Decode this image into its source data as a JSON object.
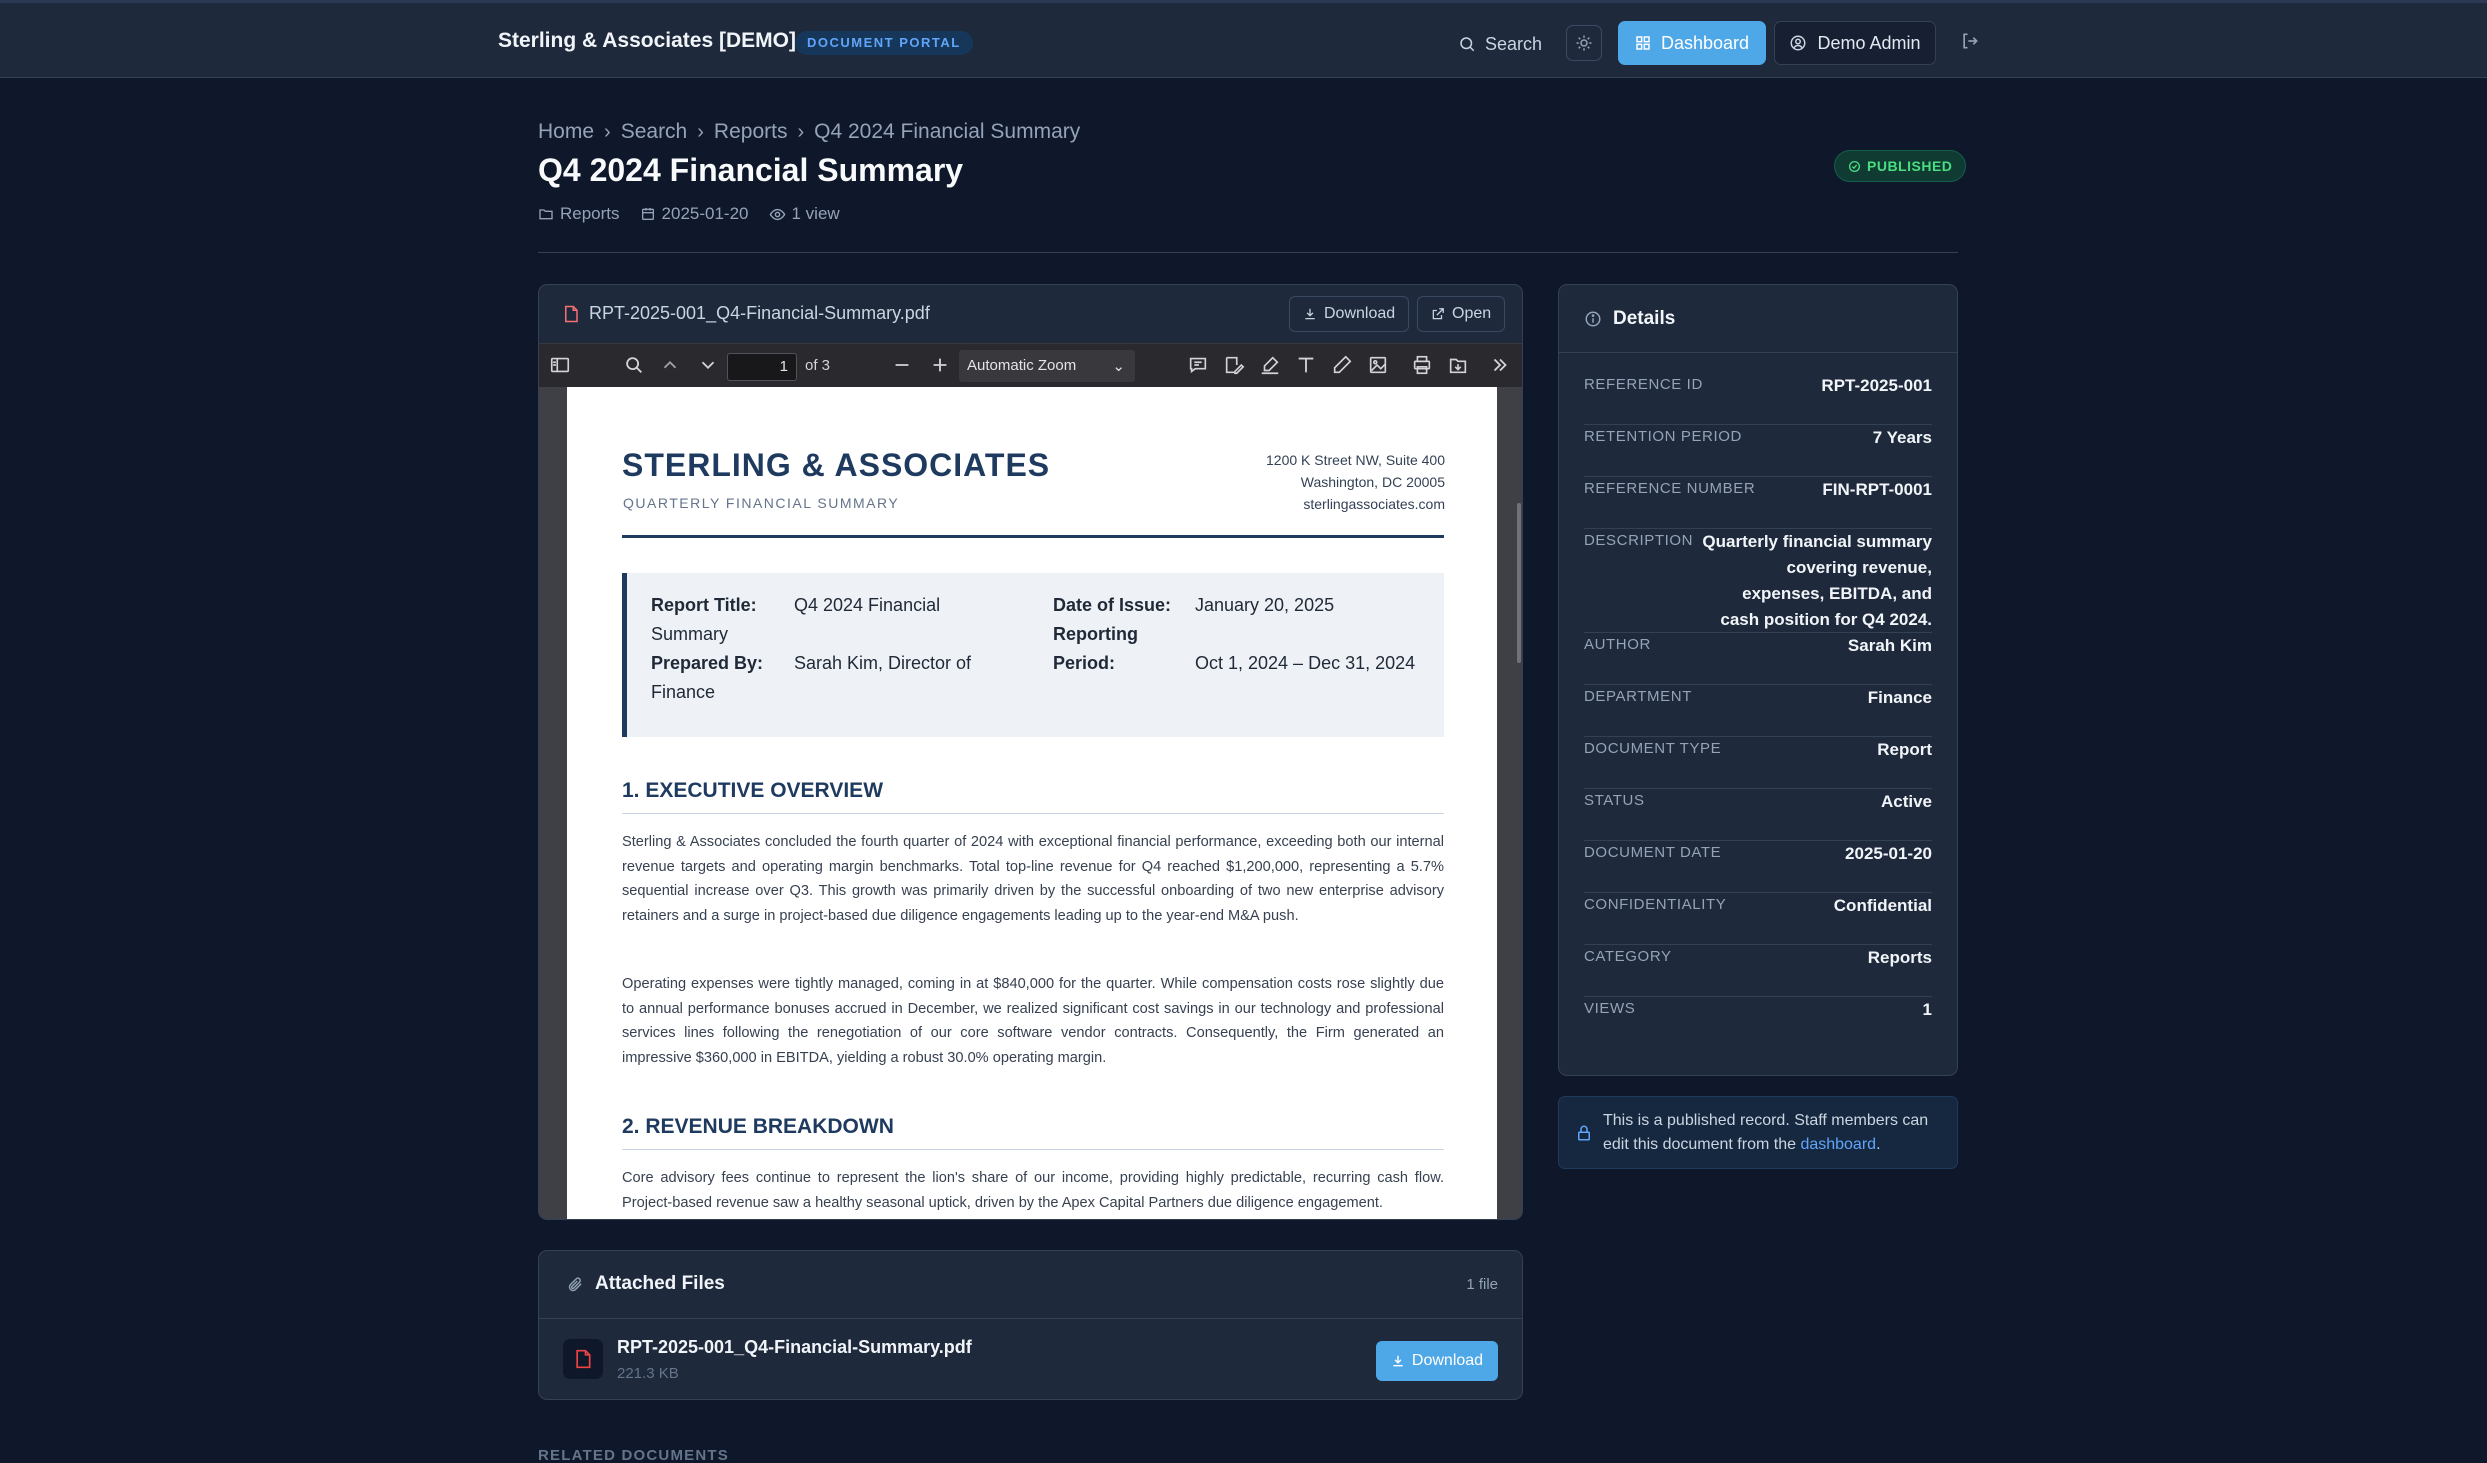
{
  "header": {
    "brand": "Sterling & Associates [DEMO]",
    "portal_badge": "DOCUMENT PORTAL",
    "search_label": "Search",
    "dashboard_label": "Dashboard",
    "user_label": "Demo Admin"
  },
  "breadcrumb": [
    "Home",
    "Search",
    "Reports",
    "Q4 2024 Financial Summary"
  ],
  "page": {
    "title": "Q4 2024 Financial Summary",
    "status_badge": "PUBLISHED",
    "meta_category": "Reports",
    "meta_date": "2025-01-20",
    "meta_views": "1 view"
  },
  "viewer": {
    "file_name": "RPT-2025-001_Q4-Financial-Summary.pdf",
    "download_label": "Download",
    "open_label": "Open",
    "current_page": "1",
    "page_count": "of 3",
    "zoom": "Automatic Zoom"
  },
  "pdf": {
    "company": "STERLING & ASSOCIATES",
    "subtitle": "QUARTERLY FINANCIAL SUMMARY",
    "address_line1": "1200 K Street NW, Suite 400",
    "address_line2": "Washington, DC 20005",
    "address_line3": "sterlingassociates.com",
    "report_title_label": "Report Title:",
    "report_title_value_1": "Q4 2024 Financial",
    "report_title_value_2": "Summary",
    "prepared_by_label": "Prepared By:",
    "prepared_by_value_1": "Sarah Kim, Director of",
    "prepared_by_value_2": "Finance",
    "date_label": "Date of Issue:",
    "date_value": "January 20, 2025",
    "period_label_1": "Reporting",
    "period_label_2": "Period:",
    "period_value": "Oct 1, 2024 – Dec 31, 2024",
    "section1_title": "1. EXECUTIVE OVERVIEW",
    "section1_p1": "Sterling & Associates concluded the fourth quarter of 2024 with exceptional financial performance, exceeding both our internal revenue targets and operating margin benchmarks. Total top-line revenue for Q4 reached $1,200,000, representing a 5.7% sequential increase over Q3. This growth was primarily driven by the successful onboarding of two new enterprise advisory retainers and a surge in project-based due diligence engagements leading up to the year-end M&A push.",
    "section1_p2": "Operating expenses were tightly managed, coming in at $840,000 for the quarter. While compensation costs rose slightly due to annual performance bonuses accrued in December, we realized significant cost savings in our technology and professional services lines following the renegotiation of our core software vendor contracts. Consequently, the Firm generated an impressive $360,000 in EBITDA, yielding a robust 30.0% operating margin.",
    "section2_title": "2. REVENUE BREAKDOWN",
    "section2_p1": "Core advisory fees continue to represent the lion's share of our income, providing highly predictable, recurring cash flow. Project-based revenue saw a healthy seasonal uptick, driven by the Apex Capital Partners due diligence engagement."
  },
  "details": {
    "title": "Details",
    "rows": [
      {
        "label": "Reference ID",
        "value": "RPT-2025-001"
      },
      {
        "label": "Retention Period",
        "value": "7 Years"
      },
      {
        "label": "Reference Number",
        "value": "FIN-RPT-0001"
      },
      {
        "label": "Description",
        "value": "Quarterly financial summary covering revenue, expenses, EBITDA, and cash position for Q4 2024."
      },
      {
        "label": "Author",
        "value": "Sarah Kim"
      },
      {
        "label": "Department",
        "value": "Finance"
      },
      {
        "label": "Document Type",
        "value": "Report"
      },
      {
        "label": "Status",
        "value": "Active"
      },
      {
        "label": "Document Date",
        "value": "2025-01-20"
      },
      {
        "label": "Confidentiality",
        "value": "Confidential"
      },
      {
        "label": "Category",
        "value": "Reports"
      },
      {
        "label": "Views",
        "value": "1"
      }
    ]
  },
  "notice": {
    "text": "This is a published record. Staff members can edit this document from the ",
    "link": "dashboard",
    "end": "."
  },
  "attachments": {
    "title": "Attached Files",
    "count": "1 file",
    "file_name": "RPT-2025-001_Q4-Financial-Summary.pdf",
    "file_size": "221.3 KB",
    "download_label": "Download"
  },
  "related_heading": "RELATED DOCUMENTS",
  "colors": {
    "background": "#0f172a",
    "panel": "#1e293b",
    "accent": "#4ea8e8",
    "published": "#4ade80",
    "pdf_heading": "#1e3a5f"
  }
}
